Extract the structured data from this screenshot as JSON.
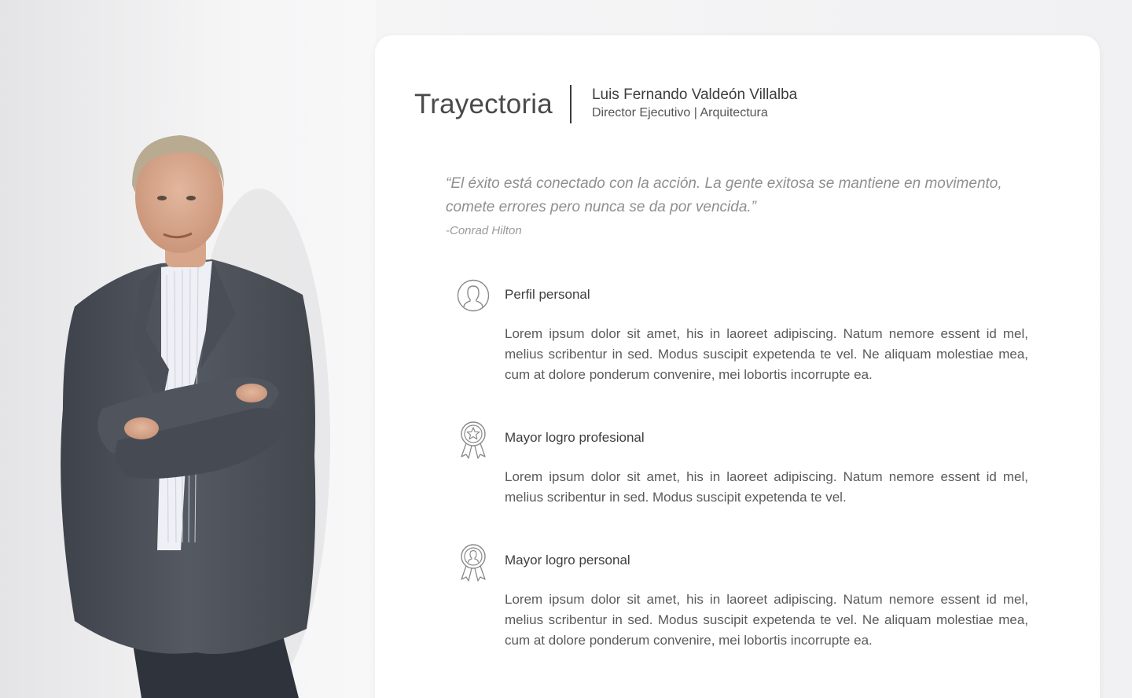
{
  "header": {
    "title": "Trayectoria",
    "person_name": "Luis Fernando Valdeón Villalba",
    "person_role": "Director Ejecutivo | Arquitectura"
  },
  "quote": {
    "text": "“El éxito está conectado con la acción. La gente exitosa se mantiene en movimento, comete errores pero nunca se da por vencida.”",
    "author": "-Conrad Hilton"
  },
  "sections": [
    {
      "icon": "user-profile-icon",
      "title": "Perfil personal",
      "body": "Lorem ipsum dolor sit amet, his in laoreet adipiscing. Natum nemore essent id mel, melius scribentur in sed. Modus suscipit expetenda te vel. Ne aliquam molestiae mea, cum at dolore ponderum convenire, mei lobortis incorrupte ea."
    },
    {
      "icon": "award-star-icon",
      "title": "Mayor logro profesional",
      "body": "Lorem ipsum dolor sit amet, his in laoreet adipiscing. Natum nemore essent id mel, melius scribentur in sed. Modus suscipit expetenda te vel."
    },
    {
      "icon": "award-person-icon",
      "title": "Mayor logro personal",
      "body": "Lorem ipsum dolor sit amet, his in laoreet adipiscing. Natum nemore essent id mel, melius scribentur in sed. Modus suscipit expetenda te vel. Ne aliquam molestiae mea, cum at dolore ponderum convenire, mei lobortis incorrupte ea."
    }
  ],
  "colors": {
    "background": "#f3f3f5",
    "card": "#ffffff",
    "icon_stroke": "#8a8a8a",
    "jacket": "#4b5058"
  }
}
